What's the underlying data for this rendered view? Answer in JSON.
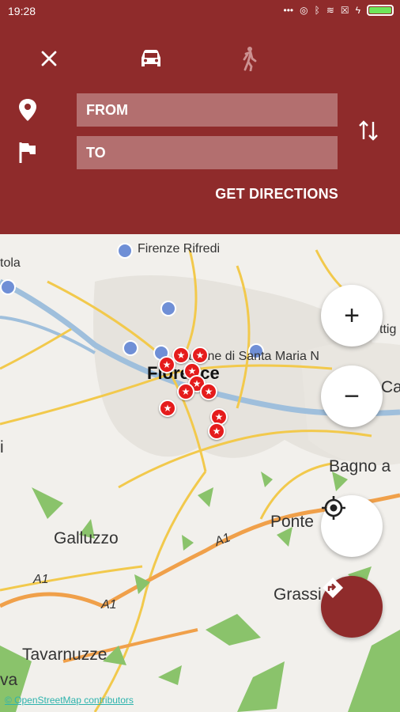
{
  "status_bar": {
    "time": "19:28",
    "icons": [
      "dots-icon",
      "sync-icon",
      "bluetooth-icon",
      "wifi-icon",
      "sim-icon",
      "charging-icon",
      "battery-icon"
    ]
  },
  "route_panel": {
    "modes": [
      {
        "name": "close",
        "icon": "close-icon"
      },
      {
        "name": "car",
        "icon": "car-icon",
        "selected": true
      },
      {
        "name": "walk",
        "icon": "walk-icon",
        "selected": false
      }
    ],
    "from_placeholder": "FROM",
    "to_placeholder": "TO",
    "get_directions": "GET DIRECTIONS",
    "colors": {
      "panel": "#8f2b2b",
      "field": "#ffffff52"
    }
  },
  "map": {
    "places": [
      {
        "name": "Firenze Rifredi"
      },
      {
        "name": "Stazione di Santa Maria N"
      },
      {
        "name": "Florence"
      },
      {
        "name": "Bagno a"
      },
      {
        "name": "Ponte"
      },
      {
        "name": "Galluzzo"
      },
      {
        "name": "Grassi"
      },
      {
        "name": "Tavarnuzze"
      },
      {
        "name": "tola"
      },
      {
        "name": "ttig"
      },
      {
        "name": "Can"
      },
      {
        "name": "va"
      },
      {
        "name": "i"
      }
    ],
    "road_labels": [
      "A1",
      "A1",
      "A1"
    ],
    "attribution": "© OpenStreetMap contributors"
  },
  "controls": {
    "zoom_in": "+",
    "zoom_out": "−",
    "locate_icon": "crosshair-icon",
    "route_icon": "directions-icon"
  }
}
